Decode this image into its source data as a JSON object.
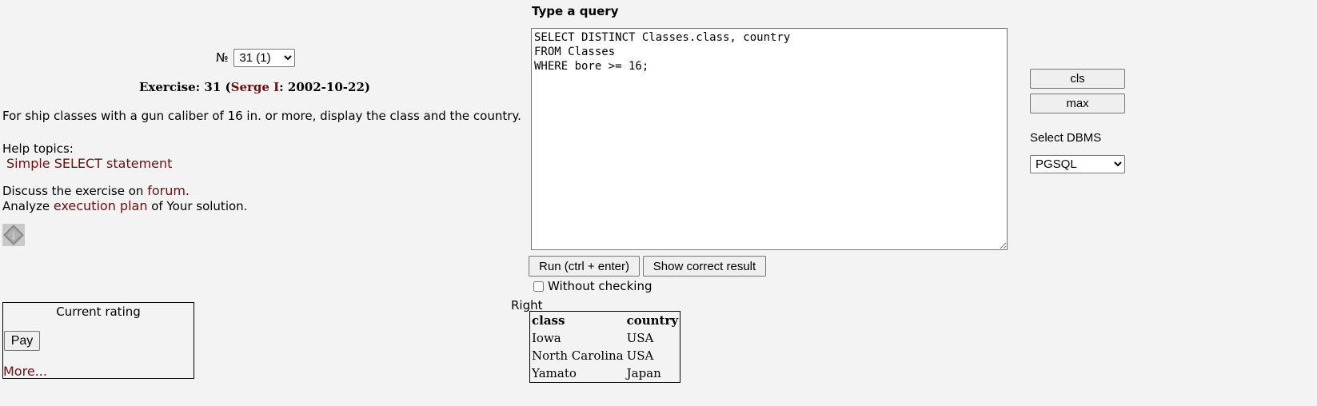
{
  "exercise": {
    "number_label": "№",
    "selected": "31 (1)",
    "title_prefix": "Exercise: 31 (",
    "author": "Serge I",
    "title_suffix": ": 2002-10-22)",
    "description": "For ship classes with a gun caliber of 16 in. or more, display the class and the country.",
    "help_label": "Help topics:",
    "help_link": "Simple SELECT statement",
    "discuss_prefix": "Discuss the exercise on ",
    "forum_link": "forum",
    "discuss_suffix": ".",
    "analyze_prefix": "Analyze ",
    "plan_link": "execution plan",
    "analyze_suffix": " of Your solution."
  },
  "rating": {
    "title": "Current rating",
    "pay_label": "Pay",
    "more_link": "More..."
  },
  "query": {
    "heading": "Type a query",
    "text": "SELECT DISTINCT Classes.class, country\nFROM Classes\nWHERE bore >= 16;",
    "run_label": "Run (ctrl + enter)",
    "show_label": "Show correct result",
    "without_checking_label": "Without checking"
  },
  "side": {
    "cls_label": "cls",
    "max_label": "max",
    "dbms_label": "Select DBMS",
    "dbms_selected": "PGSQL"
  },
  "result": {
    "status": "Right",
    "columns": [
      "class",
      "country"
    ],
    "rows": [
      [
        "Iowa",
        "USA"
      ],
      [
        "North Carolina",
        "USA"
      ],
      [
        "Yamato",
        "Japan"
      ]
    ]
  },
  "colors": {
    "link": "#6b0f0f",
    "background": "#f3f3f3"
  },
  "icons": {
    "info": "info-diamond-icon"
  }
}
